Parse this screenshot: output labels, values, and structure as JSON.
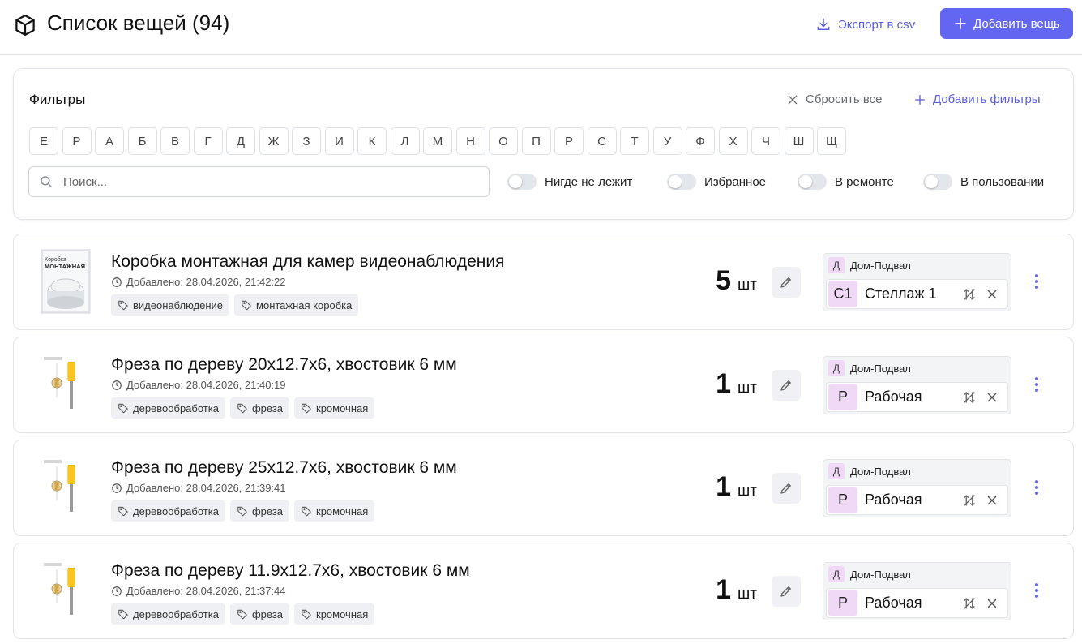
{
  "header": {
    "title": "Список вещей (94)",
    "export_label": "Экспорт в csv",
    "add_label": "Добавить вещь"
  },
  "filters": {
    "title": "Фильтры",
    "reset_label": "Сбросить все",
    "add_filters_label": "Добавить фильтры",
    "letters": [
      "Е",
      "Р",
      "А",
      "Б",
      "В",
      "Г",
      "Д",
      "Ж",
      "З",
      "И",
      "К",
      "Л",
      "М",
      "Н",
      "О",
      "П",
      "Р",
      "С",
      "Т",
      "У",
      "Ф",
      "Х",
      "Ч",
      "Ш",
      "Щ"
    ],
    "search_placeholder": "Поиск...",
    "toggles": [
      "Нигде не лежит",
      "Избранное",
      "В ремонте",
      "В пользовании"
    ]
  },
  "items": [
    {
      "name": "Коробка монтажная для камер видеонаблюдения",
      "date": "Добавлено: 28.04.2026, 21:42:22",
      "tags": [
        "видеонаблюдение",
        "монтажная коробка"
      ],
      "qty": "5",
      "unit": "шт",
      "house_badge": "Д",
      "house": "Дом-Подвал",
      "place_badge": "С1",
      "place": "Стеллаж 1",
      "thumb_text": [
        "Коробка",
        "МОНТАЖНАЯ"
      ]
    },
    {
      "name": "Фреза по дереву 20х12.7х6, хвостовик 6 мм",
      "date": "Добавлено: 28.04.2026, 21:40:19",
      "tags": [
        "деревообработка",
        "фреза",
        "кромочная"
      ],
      "qty": "1",
      "unit": "шт",
      "house_badge": "Д",
      "house": "Дом-Подвал",
      "place_badge": "Р",
      "place": "Рабочая"
    },
    {
      "name": "Фреза по дереву 25х12.7х6, хвостовик 6 мм",
      "date": "Добавлено: 28.04.2026, 21:39:41",
      "tags": [
        "деревообработка",
        "фреза",
        "кромочная"
      ],
      "qty": "1",
      "unit": "шт",
      "house_badge": "Д",
      "house": "Дом-Подвал",
      "place_badge": "Р",
      "place": "Рабочая"
    },
    {
      "name": "Фреза по дереву 11.9х12.7х6, хвостовик 6 мм",
      "date": "Добавлено: 28.04.2026, 21:37:44",
      "tags": [
        "деревообработка",
        "фреза",
        "кромочная"
      ],
      "qty": "1",
      "unit": "шт",
      "house_badge": "Д",
      "house": "Дом-Подвал",
      "place_badge": "Р",
      "place": "Рабочая"
    }
  ],
  "colors": {
    "accent": "#6366f1",
    "badge": "#f0d8f7"
  }
}
